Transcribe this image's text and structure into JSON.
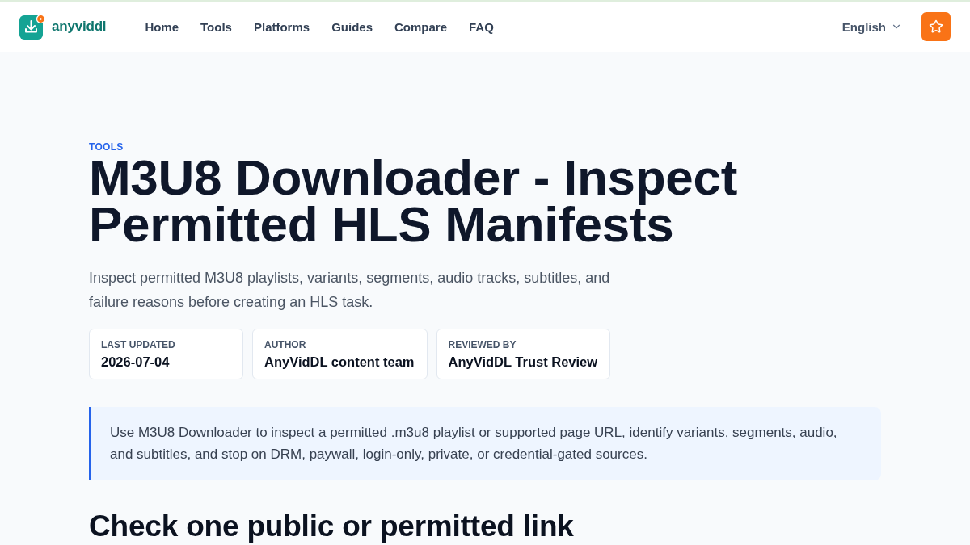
{
  "header": {
    "logo_text": "anyviddl",
    "nav": [
      {
        "label": "Home"
      },
      {
        "label": "Tools"
      },
      {
        "label": "Platforms"
      },
      {
        "label": "Guides"
      },
      {
        "label": "Compare"
      },
      {
        "label": "FAQ"
      }
    ],
    "language": "English"
  },
  "hero": {
    "eyebrow": "TOOLS",
    "title": "M3U8 Downloader - Inspect Permitted HLS Manifests",
    "subtitle": "Inspect permitted M3U8 playlists, variants, segments, audio tracks, subtitles, and failure reasons before creating an HLS task.",
    "meta": [
      {
        "label": "LAST UPDATED",
        "value": "2026-07-04"
      },
      {
        "label": "AUTHOR",
        "value": "AnyVidDL content team"
      },
      {
        "label": "REVIEWED BY",
        "value": "AnyVidDL Trust Review"
      }
    ]
  },
  "callout": "Use M3U8 Downloader to inspect a permitted .m3u8 playlist or supported page URL, identify variants, segments, audio, and subtitles, and stop on DRM, paywall, login-only, private, or credential-gated sources.",
  "section_heading": "Check one public or permitted link"
}
